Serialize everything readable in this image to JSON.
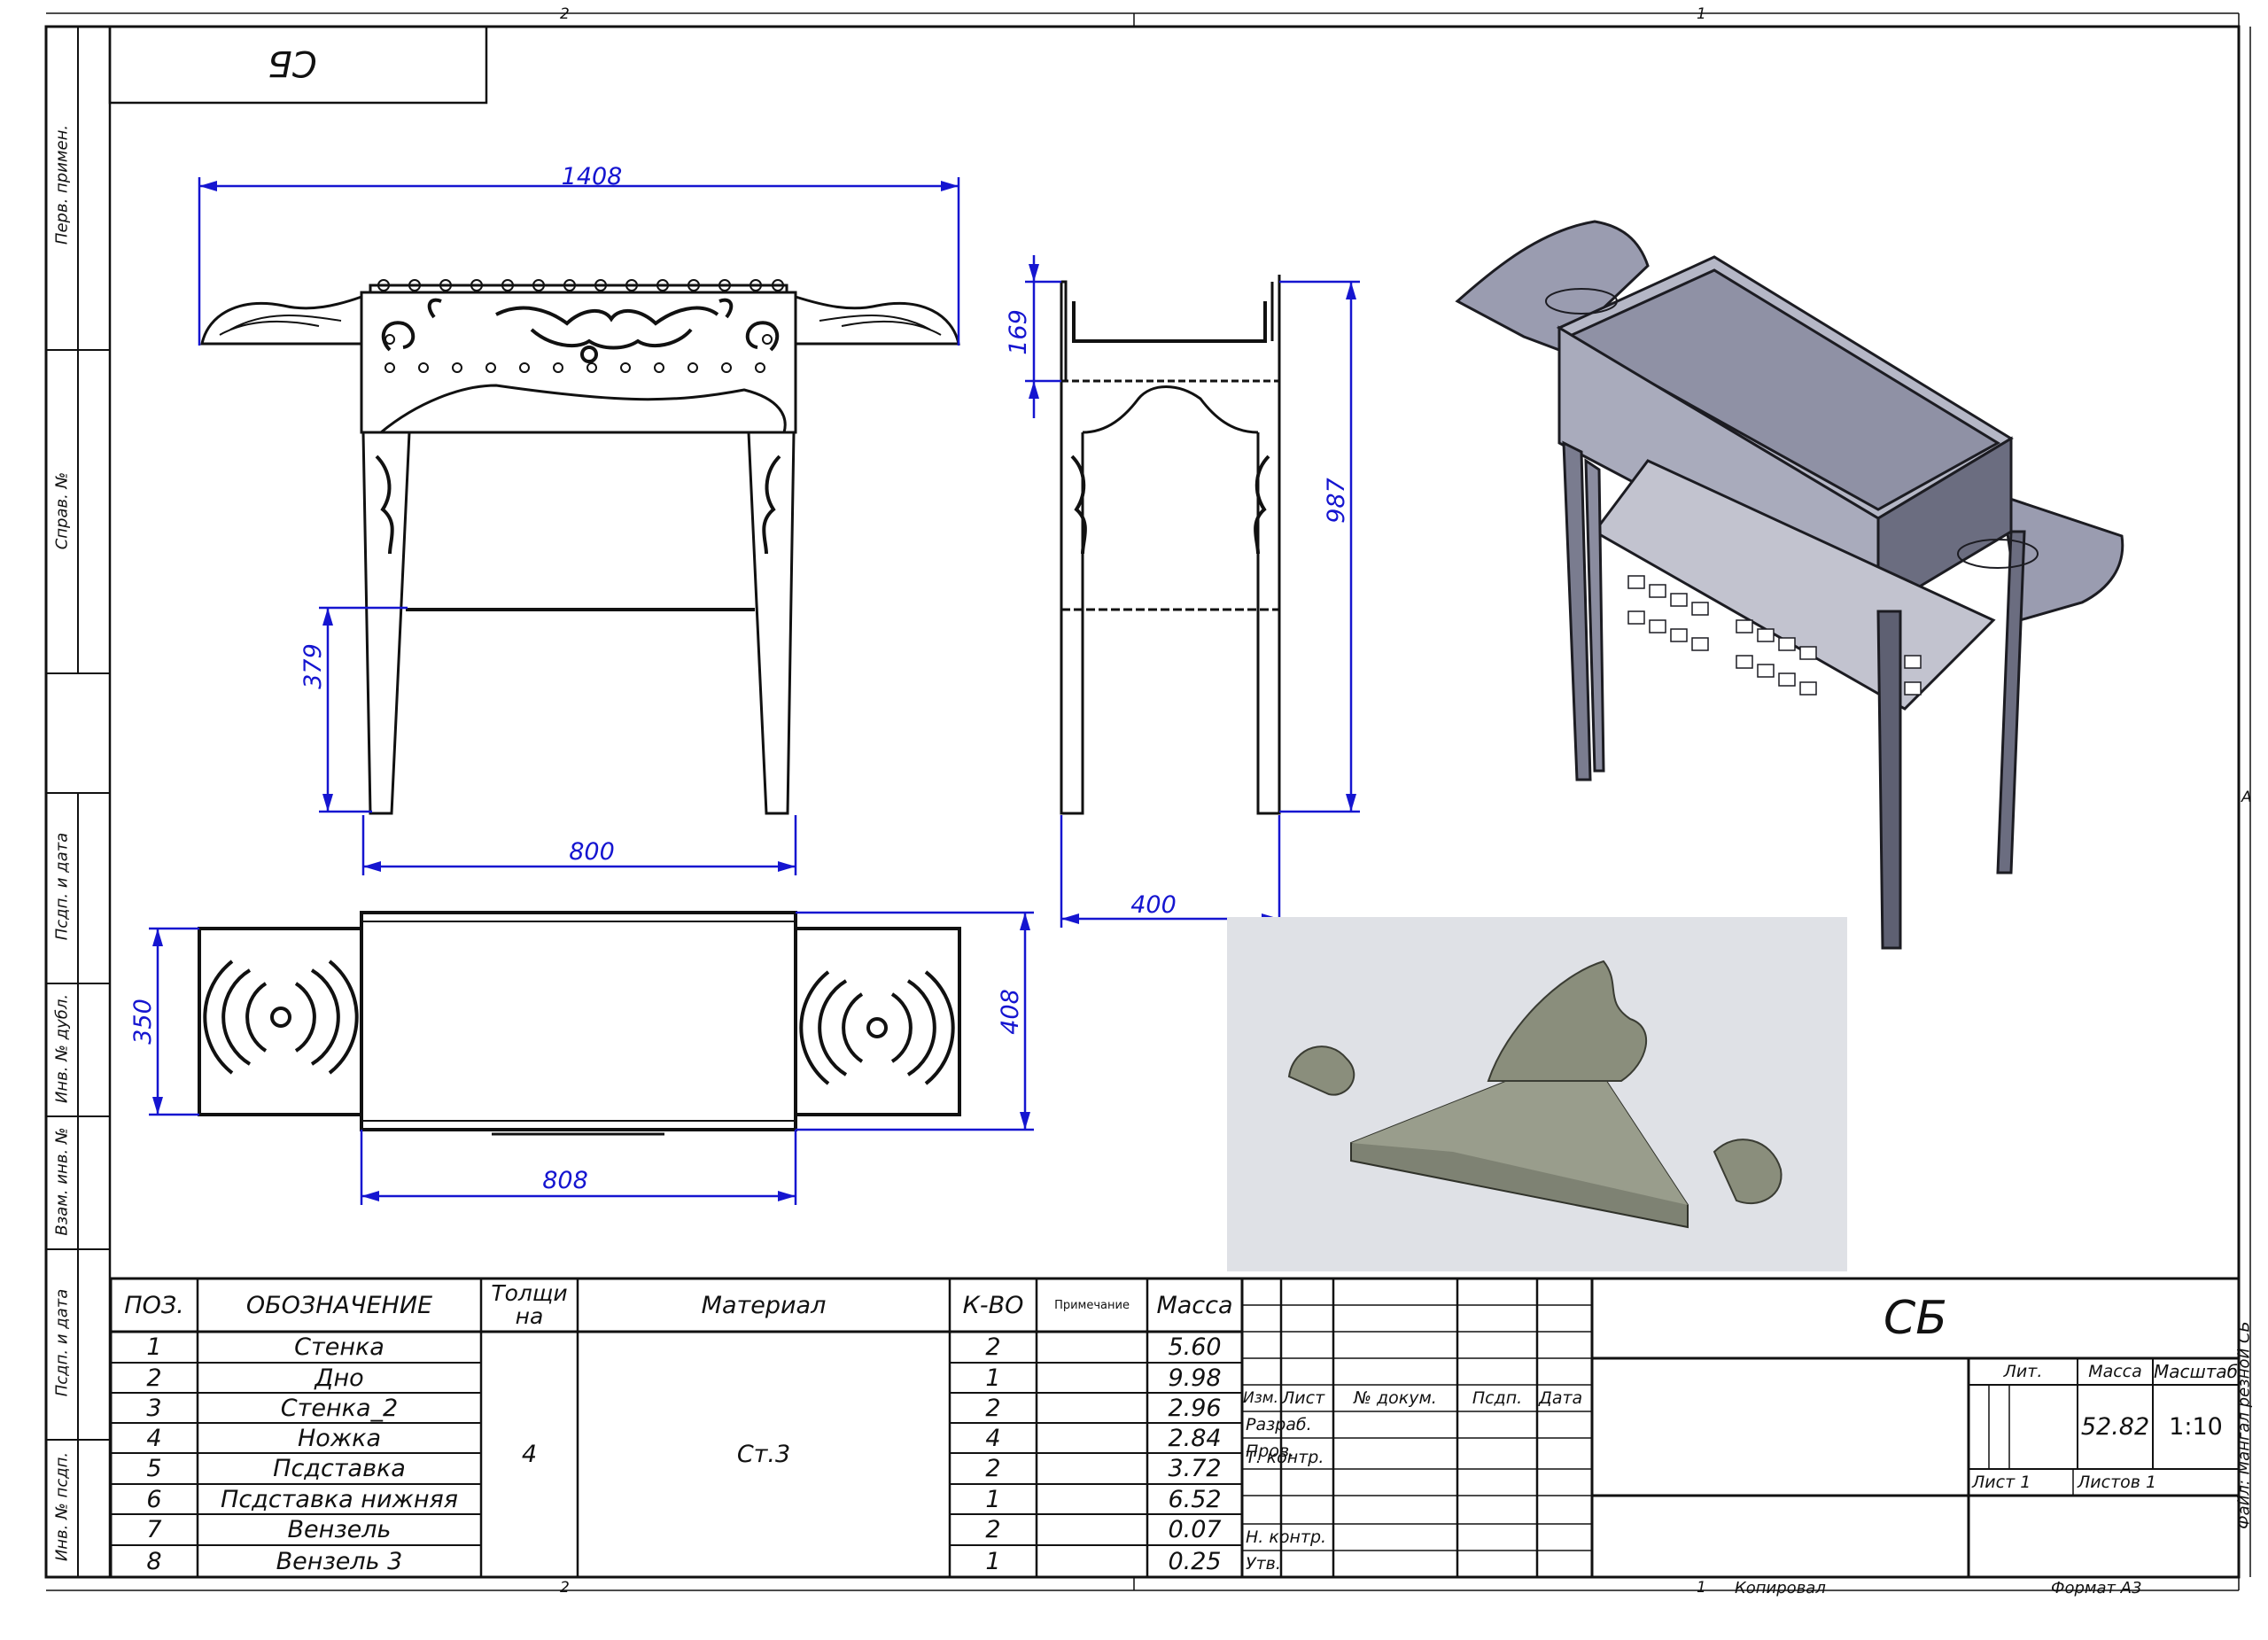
{
  "corner_stamp": "СБ",
  "zone_markers": {
    "top_left": "2",
    "top_right": "1",
    "bottom_left": "2",
    "bottom_right_sheet": "1",
    "right_side": "А"
  },
  "side_strip": {
    "labels": [
      "Перв. примен.",
      "Справ. №",
      "Пcдп. и дата",
      "Инв. № дубл.",
      "Взам. инв. №",
      "Пcдп. и дата",
      "Инв. № пcдп."
    ]
  },
  "dimensions": {
    "overall_length": "1408",
    "body_length": "800",
    "leg_brace_height": "379",
    "side_depth_top": "169",
    "total_height": "987",
    "side_width": "400",
    "plan_shelf_width": "350",
    "plan_body_width": "408",
    "plan_body_length": "808"
  },
  "spec_table": {
    "headers": {
      "pos": "ПОЗ.",
      "designation": "ОБОЗНАЧЕНИЕ",
      "thickness": "Толщина",
      "material": "Материал",
      "qty": "К-ВО",
      "note": "Примечание",
      "mass": "Масса"
    },
    "thickness_value": "4",
    "material_value": "Ст.3",
    "rows": [
      {
        "pos": "1",
        "name": "Стенка",
        "qty": "2",
        "mass": "5.60"
      },
      {
        "pos": "2",
        "name": "Дно",
        "qty": "1",
        "mass": "9.98"
      },
      {
        "pos": "3",
        "name": "Стенка_2",
        "qty": "2",
        "mass": "2.96"
      },
      {
        "pos": "4",
        "name": "Ножка",
        "qty": "4",
        "mass": "2.84"
      },
      {
        "pos": "5",
        "name": "Пcдставка",
        "qty": "2",
        "mass": "3.72"
      },
      {
        "pos": "6",
        "name": "Пcдставка нижняя",
        "qty": "1",
        "mass": "6.52"
      },
      {
        "pos": "7",
        "name": "Вензель",
        "qty": "2",
        "mass": "0.07"
      },
      {
        "pos": "8",
        "name": "Вензель 3",
        "qty": "1",
        "mass": "0.25"
      }
    ]
  },
  "title_block": {
    "doc_code": "СБ",
    "col_headers": {
      "izm": "Изм.",
      "list": "Лист",
      "doc_no": "№ докум.",
      "sign": "Пcдп.",
      "date": "Дата"
    },
    "roles": [
      "Разраб.",
      "Пров.",
      "Т. контр.",
      "Н. контр.",
      "Утв."
    ],
    "lit_label": "Лит.",
    "mass_label": "Масса",
    "scale_label": "Масштаб",
    "mass_value": "52.82",
    "scale_value": "1:10",
    "sheet_label": "Лист 1",
    "sheets_label": "Листов 1",
    "file_label": "Файл: Мангал резной СБ",
    "copied_label": "Копировал",
    "format_label": "Формат А3"
  }
}
